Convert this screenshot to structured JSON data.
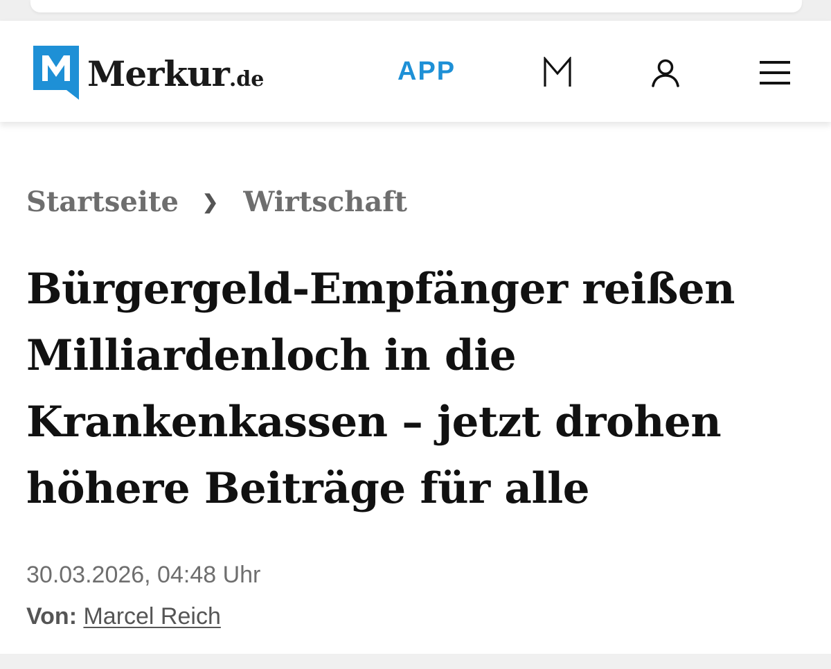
{
  "header": {
    "logo": {
      "name": "Merkur",
      "suffix": ".de"
    },
    "app_label": "APP",
    "icons": [
      "m-icon",
      "user-icon",
      "menu-icon"
    ],
    "accent_color": "#1e90d6"
  },
  "breadcrumb": {
    "items": [
      "Startseite",
      "Wirtschaft"
    ],
    "separator": "❯"
  },
  "article": {
    "headline": "Bürgergeld-Empfänger reißen Milliardenloch in die Krankenkassen – jetzt drohen höhere Beiträge für alle",
    "date": "30.03.2026, 04:48 Uhr",
    "author_label": "Von:",
    "author_name": "Marcel Reich"
  }
}
